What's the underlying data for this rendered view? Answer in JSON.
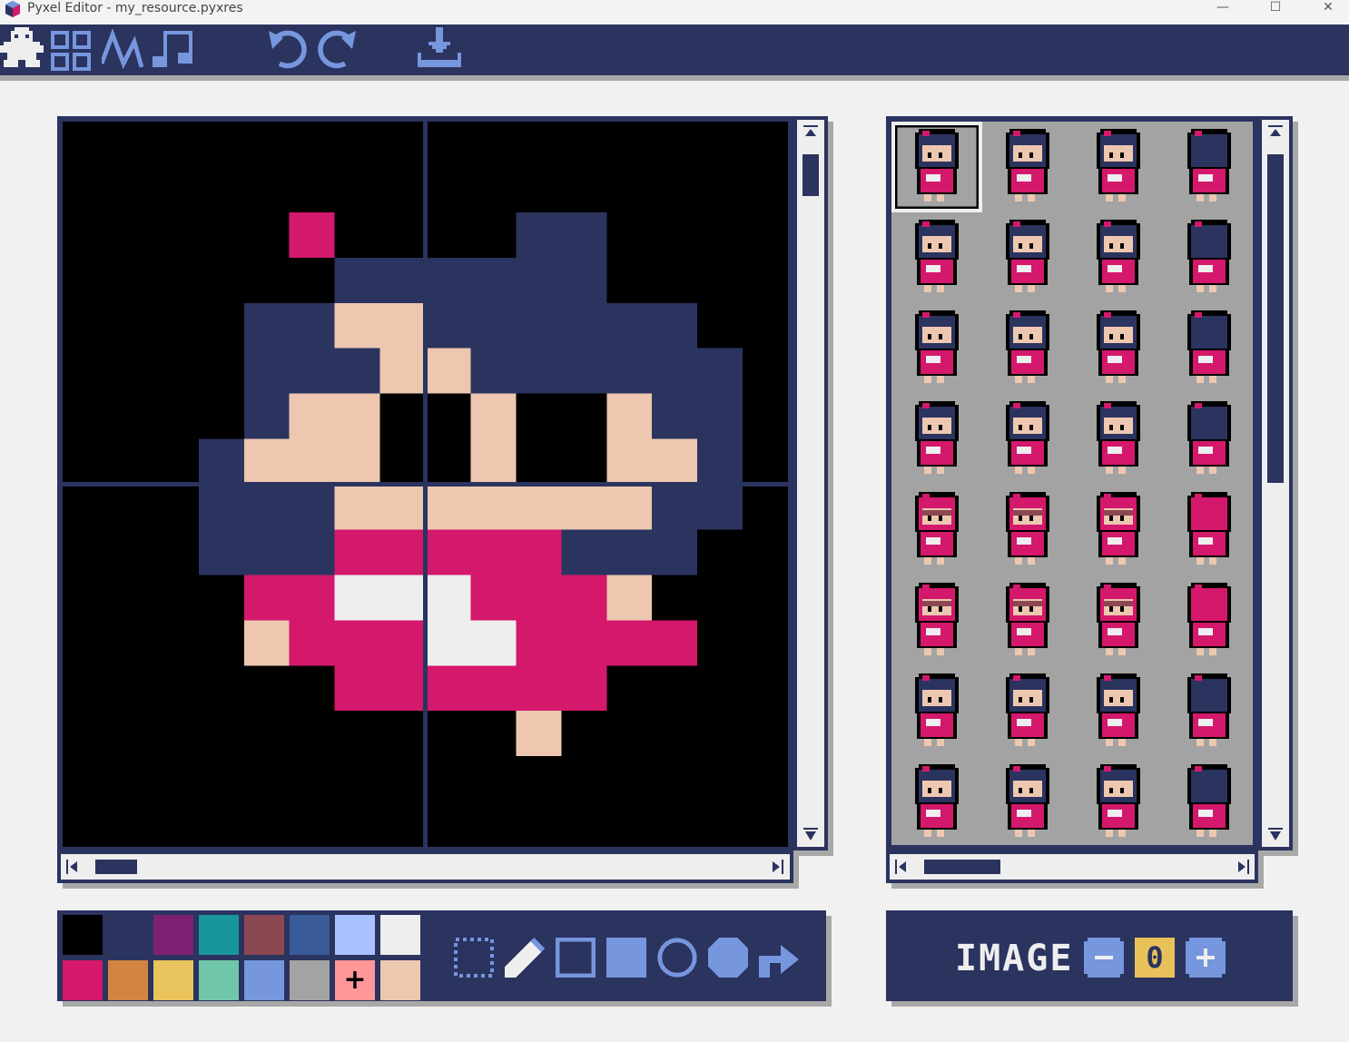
{
  "window": {
    "title": "Pyxel Editor - my_resource.pyxres",
    "minimize_glyph": "—",
    "maximize_glyph": "☐",
    "close_glyph": "✕"
  },
  "toolbar": {
    "icons": [
      "image-editor-icon",
      "tilemap-editor-icon",
      "sound-editor-icon",
      "music-editor-icon",
      "undo-icon",
      "redo-icon",
      "save-icon"
    ]
  },
  "palette": {
    "colors": [
      "#000000",
      "#2b335f",
      "#7e2072",
      "#19959c",
      "#8b4852",
      "#395c98",
      "#a9c1ff",
      "#eeeeee",
      "#d4186c",
      "#d38441",
      "#e9c35b",
      "#70c6a9",
      "#7696de",
      "#a3a3a3",
      "#ff9798",
      "#edc7b0"
    ],
    "selected_index": 14,
    "selected_marker": "+"
  },
  "tools": [
    "select-tool-icon",
    "pencil-tool-icon",
    "rect-tool-icon",
    "filled-rect-tool-icon",
    "circle-tool-icon",
    "filled-circle-tool-icon",
    "bucket-tool-icon"
  ],
  "image_bank": {
    "label": "IMAGE",
    "value": "0",
    "minus": "−",
    "plus": "+"
  },
  "colors": {
    "navy": "#2b335f",
    "pink": "#d4186c",
    "skin": "#edc7b0",
    "white": "#eeeeee",
    "black": "#000000",
    "accent": "#7696de",
    "yellow": "#e8c15a",
    "gray": "#a3a3a3"
  },
  "canvas": {
    "sprite_rows": [
      "................",
      "................",
      ".....P....NN....",
      "......NNNNNN....",
      "....NNSSNNNNNN..",
      "....NNNSSNNNNNN.",
      "....NSSKKSKKSNN.",
      "...NSSSKKSKKSSN.",
      "...NNNSSSSSSSNN.",
      "...NNNPPPPPNNN..",
      "....PPWWWPPPS...",
      "....SPPPWWPPPP..",
      "......PPPPPP....",
      "..........S.....",
      "................",
      "................"
    ]
  }
}
